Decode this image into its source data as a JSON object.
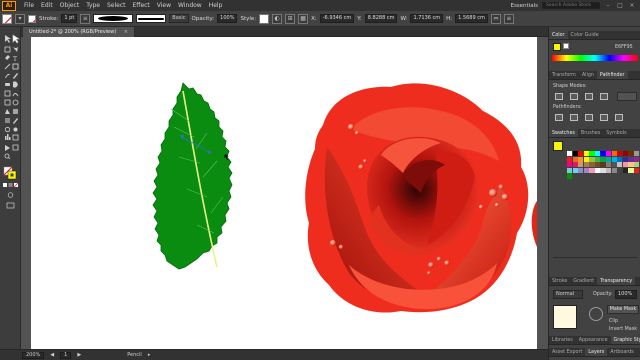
{
  "app": {
    "logo": "Ai",
    "menu": [
      "File",
      "Edit",
      "Object",
      "Type",
      "Select",
      "Effect",
      "View",
      "Window",
      "Help"
    ],
    "workspace": "Essentials",
    "search_placeholder": "Search Adobe Stock",
    "window_controls": [
      "–",
      "□",
      "×"
    ]
  },
  "control_bar": {
    "stroke_label": "Stroke:",
    "stroke_value": "1 pt",
    "uniform_label": "Basic",
    "opacity_label": "Opacity:",
    "opacity_value": "100%",
    "style_label": "Style:",
    "x_label": "X:",
    "x_value": "-6.9346 cm",
    "y_label": "Y:",
    "y_value": "8.8288 cm",
    "w_label": "W:",
    "w_value": "1.7136 cm",
    "h_label": "H:",
    "h_value": "1.5689 cm"
  },
  "document": {
    "tab_title": "Untitled-2* @ 200% (RGB/Preview)",
    "close": "×"
  },
  "status_bar": {
    "zoom": "200%",
    "page": "1",
    "tool": "Pencil"
  },
  "panels": {
    "color_tabs": [
      "Color",
      "Color Guide"
    ],
    "hex_value": "E6FF95",
    "transform_tabs": [
      "Transform",
      "Align",
      "Pathfinder"
    ],
    "shape_modes_label": "Shape Modes:",
    "pathfinders_label": "Pathfinders:",
    "swatch_tabs": [
      "Swatches",
      "Brushes",
      "Symbols"
    ],
    "stroke_tabs": [
      "Stroke",
      "Gradient",
      "Transparency"
    ],
    "blend_mode": "Normal",
    "opacity_label": "Opacity:",
    "opacity_value": "100%",
    "make_mask": "Make Mask",
    "clip": "Clip",
    "invert_mask": "Invert Mask",
    "bottom_tabs": [
      "Libraries",
      "Appearance",
      "Graphic Styles"
    ],
    "bottom_tabs2": [
      "Asset Export",
      "Layers",
      "Artboards"
    ]
  },
  "colors": {
    "leaf": "#0a8c11",
    "leaf_vein": "#e8f08a",
    "rose_main": "#e2241a",
    "rose_light": "#f75a3c",
    "rose_dark": "#6b0a08",
    "accent_yellow": "#f7f700"
  },
  "swatches": [
    "#ffffff",
    "#000000",
    "#ff0000",
    "#ffff00",
    "#00ff00",
    "#00ffff",
    "#0000ff",
    "#ff00ff",
    "#ff6600",
    "#cc0000",
    "#990000",
    "#663300",
    "#999999",
    "#ed1c24",
    "#f26522",
    "#f7941d",
    "#fff200",
    "#8dc63f",
    "#39b54a",
    "#00a651",
    "#00a99d",
    "#00aeef",
    "#0072bc",
    "#2e3192",
    "#662d91",
    "#92278f",
    "#ec008c",
    "#ed145b",
    "#c69c6d",
    "#a67c52",
    "#8c6239",
    "#754c24",
    "#603913",
    "#7d7d7d",
    "#555555",
    "#c2c2c2",
    "#f5989d",
    "#fdc689",
    "#acd373",
    "#7accc8",
    "#6dcff6",
    "#8393ca",
    "#a186be",
    "#f49ac1",
    "#ffffff",
    "#dddddd",
    "#bbbbbb",
    "#888888",
    "#444444",
    "#222222",
    "#e6ff95",
    "#e2241a",
    "#0a8c11"
  ]
}
